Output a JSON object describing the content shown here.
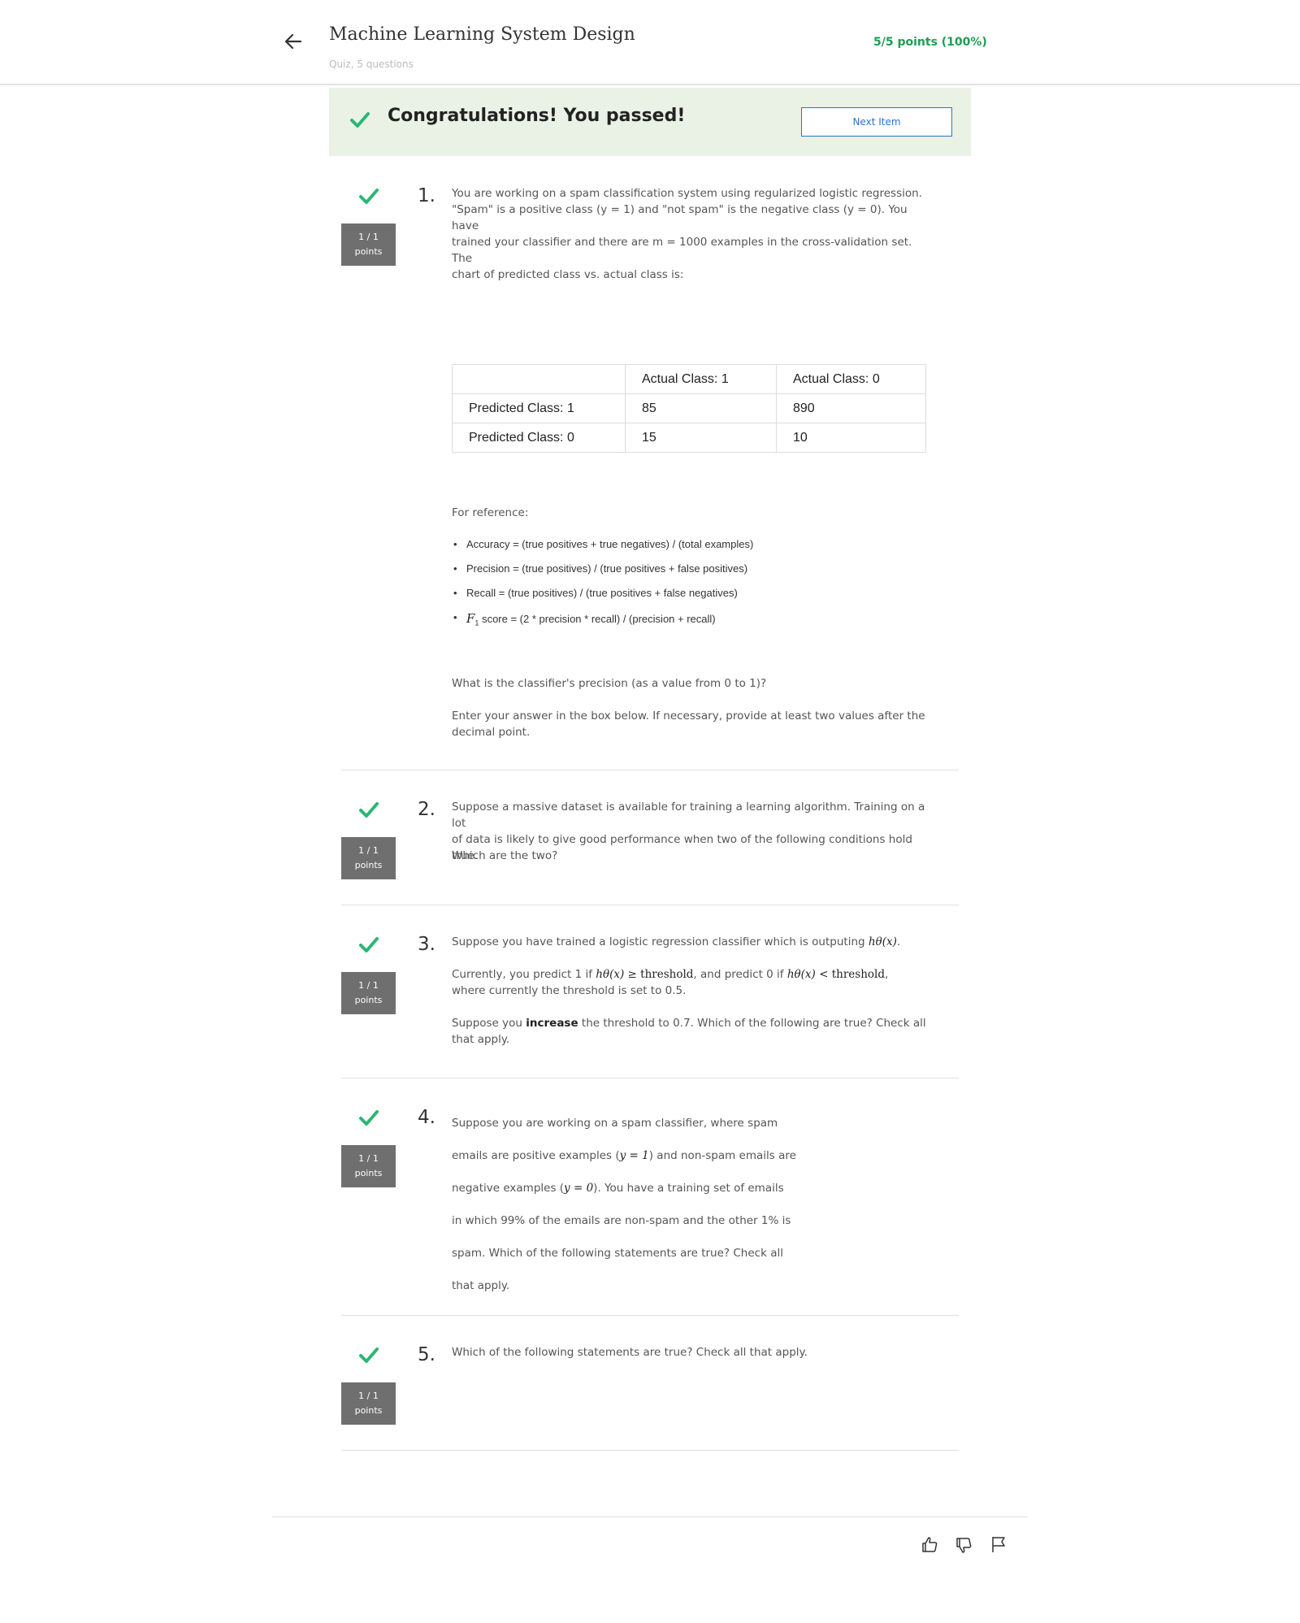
{
  "header": {
    "course_title": "Machine Learning System Design",
    "quiz_subtitle": "Quiz, 5 questions",
    "score": "5/5 points (100%)"
  },
  "banner": {
    "message": "Congratulations! You passed!",
    "next_button": "Next Item"
  },
  "colors": {
    "accent_green": "#2bb673",
    "banner_bg": "#eaf2e6",
    "link_blue": "#2a73cc",
    "points_bg": "#6f6f6f"
  },
  "questions": [
    {
      "number": "1.",
      "points_value": "1 / 1",
      "points_label": "points",
      "text_lines": [
        "You are working on a spam classification system using regularized logistic regression.",
        "\"Spam\" is a positive class (y = 1) and \"not spam\" is the negative class (y = 0). You have",
        "trained your classifier and there are m = 1000 examples in the cross-validation set. The",
        "chart of predicted class vs. actual class is:"
      ],
      "table": {
        "headers": [
          "",
          "Actual Class: 1",
          "Actual Class: 0"
        ],
        "rows": [
          [
            "Predicted Class: 1",
            "85",
            "890"
          ],
          [
            "Predicted Class: 0",
            "15",
            "10"
          ]
        ]
      },
      "reference_title": "For reference:",
      "reference_items": [
        "Accuracy = (true positives + true negatives) / (total examples)",
        "Precision = (true positives) / (true positives + false positives)",
        "Recall = (true positives) / (true positives + false negatives)",
        "score = (2 * precision * recall) / (precision + recall)"
      ],
      "f1_symbol": "F",
      "f1_subscript": "1",
      "prompt": "What is the classifier's precision (as a value from 0 to 1)?",
      "instruction_lines": [
        "Enter your answer in the box below. If necessary, provide at least two values after the",
        "decimal point."
      ]
    },
    {
      "number": "2.",
      "points_value": "1 / 1",
      "points_label": "points",
      "text_lines": [
        "Suppose a massive dataset is available for training a learning algorithm. Training on a lot",
        "of data is likely to give good performance when two of the following conditions hold true."
      ],
      "prompt": "Which are the two?"
    },
    {
      "number": "3.",
      "points_value": "1 / 1",
      "points_label": "points",
      "line1_prefix": "Suppose you have trained a logistic regression classifier which is outputing",
      "h_theta_x": "hθ(x)",
      "line2_a": "Currently, you predict 1 if",
      "geq_threshold": "≥ threshold",
      "line2_b": ", and predict 0 if",
      "lt_threshold": "< threshold",
      "line3": "where currently the threshold is set to 0.5.",
      "line4_a": "Suppose you",
      "line4_bold": "increase",
      "line4_b": "the threshold to 0.7. Which of the following are true? Check all",
      "line5": "that apply."
    },
    {
      "number": "4.",
      "points_value": "1 / 1",
      "points_label": "points",
      "line1": "Suppose you are working on a spam classifier, where spam",
      "line2_a": "emails are positive examples (",
      "y_eq_1": "y = 1",
      "line2_b": ") and non-spam emails are",
      "line3_a": "negative examples (",
      "y_eq_0": "y = 0",
      "line3_b": "). You have a training set of emails",
      "line4": "in which 99% of the emails are non-spam and the other 1% is",
      "line5": "spam. Which of the following statements are true? Check all",
      "line6": "that apply."
    },
    {
      "number": "5.",
      "points_value": "1 / 1",
      "points_label": "points",
      "text": "Which of the following statements are true? Check all that apply."
    }
  ],
  "footer": {
    "icons": [
      "thumbs-up-icon",
      "thumbs-down-icon",
      "flag-icon"
    ]
  }
}
